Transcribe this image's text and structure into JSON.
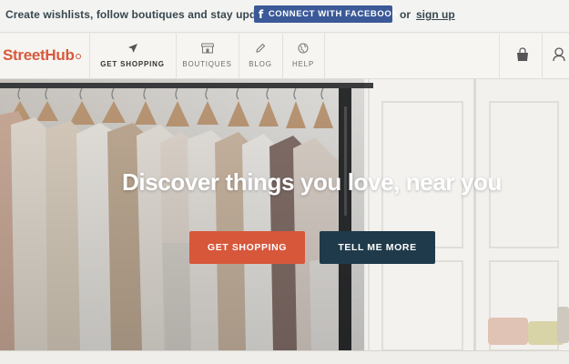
{
  "promo": {
    "text": "Create wishlists, follow boutiques and stay updated",
    "facebook_label": "CONNECT WITH FACEBOOK",
    "facebook_icon": "f",
    "or_text": "or",
    "signup_label": "sign up"
  },
  "nav": {
    "logo": "StreetHub",
    "items": [
      {
        "label": "GET SHOPPING",
        "icon": "send-arrow-icon",
        "active": true
      },
      {
        "label": "BOUTIQUES",
        "icon": "storefront-icon",
        "active": false
      },
      {
        "label": "BLOG",
        "icon": "pencil-icon",
        "active": false
      },
      {
        "label": "HELP",
        "icon": "globe-icon",
        "active": false
      }
    ],
    "right_icons": [
      "shopping-bag-icon",
      "user-icon"
    ]
  },
  "hero": {
    "title": "Discover things you love, near you",
    "primary_button": "GET SHOPPING",
    "secondary_button": "TELL ME MORE"
  },
  "colors": {
    "brand": "#d9583b",
    "primary_button": "#d7573b",
    "secondary_button": "#1f3a4a",
    "facebook": "#3b5998",
    "text_dark": "#37474f"
  }
}
